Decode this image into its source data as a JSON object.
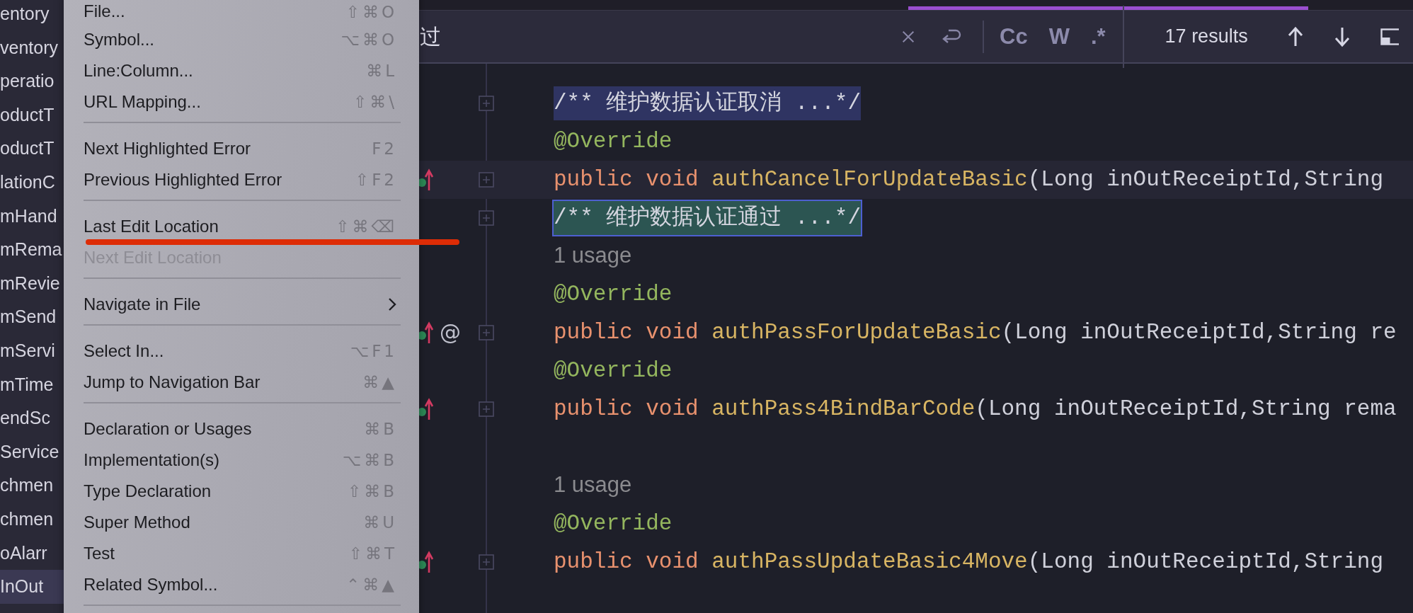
{
  "sidebar": {
    "items": [
      {
        "label": "entory",
        "selected": false
      },
      {
        "label": "ventory",
        "selected": false
      },
      {
        "label": "peratio",
        "selected": false
      },
      {
        "label": "oductT",
        "selected": false
      },
      {
        "label": "oductT",
        "selected": false
      },
      {
        "label": "lationC",
        "selected": false
      },
      {
        "label": "mHand",
        "selected": false
      },
      {
        "label": "mRema",
        "selected": false
      },
      {
        "label": "mRevie",
        "selected": false
      },
      {
        "label": "mSend",
        "selected": false
      },
      {
        "label": "mServi",
        "selected": false
      },
      {
        "label": "mTime",
        "selected": false
      },
      {
        "label": "endSc",
        "selected": false
      },
      {
        "label": "Service",
        "selected": false
      },
      {
        "label": "chmen",
        "selected": false
      },
      {
        "label": "chmen",
        "selected": false
      },
      {
        "label": "oAlarr",
        "selected": false
      },
      {
        "label": "InOut",
        "selected": true
      }
    ]
  },
  "find_bar": {
    "value": "过",
    "toggles": [
      {
        "label": "Cc"
      },
      {
        "label": "W"
      },
      {
        "label": ".*"
      }
    ],
    "results": "17 results"
  },
  "editor": {
    "lines": [
      {
        "kind": "code",
        "match": true,
        "selected_match": false,
        "current": false,
        "override": false,
        "foldable": true,
        "tokens": [
          {
            "kind": "comment",
            "text": "/** 维护数据认证取消 ...*/"
          }
        ]
      },
      {
        "kind": "code",
        "match": false,
        "selected_match": false,
        "current": false,
        "override": false,
        "foldable": false,
        "tokens": [
          {
            "kind": "annotation",
            "text": "@Override"
          }
        ]
      },
      {
        "kind": "code",
        "match": false,
        "selected_match": false,
        "current": true,
        "override": true,
        "foldable": true,
        "tokens": [
          {
            "kind": "keyword",
            "text": "public void "
          },
          {
            "kind": "method",
            "text": "authCancelForUpdateBasic"
          },
          {
            "kind": "plain",
            "text": "(Long inOutReceiptId,String"
          }
        ]
      },
      {
        "kind": "code",
        "match": true,
        "selected_match": true,
        "current": false,
        "override": false,
        "foldable": true,
        "tokens": [
          {
            "kind": "comment",
            "text": "/** 维护数据认证通过 ...*/"
          }
        ]
      },
      {
        "kind": "code",
        "match": false,
        "selected_match": false,
        "current": false,
        "override": false,
        "foldable": false,
        "tokens": [
          {
            "kind": "hint",
            "text": "1 usage"
          }
        ]
      },
      {
        "kind": "code",
        "match": false,
        "selected_match": false,
        "current": false,
        "override": false,
        "foldable": false,
        "tokens": [
          {
            "kind": "annotation",
            "text": "@Override"
          }
        ]
      },
      {
        "kind": "code",
        "match": false,
        "selected_match": false,
        "current": false,
        "override": true,
        "gutter_text": "@",
        "foldable": true,
        "tokens": [
          {
            "kind": "keyword",
            "text": "public void "
          },
          {
            "kind": "method",
            "text": "authPassForUpdateBasic"
          },
          {
            "kind": "plain",
            "text": "(Long inOutReceiptId,String re"
          }
        ]
      },
      {
        "kind": "code",
        "match": false,
        "selected_match": false,
        "current": false,
        "override": false,
        "foldable": false,
        "tokens": [
          {
            "kind": "annotation",
            "text": "@Override"
          }
        ]
      },
      {
        "kind": "code",
        "match": false,
        "selected_match": false,
        "current": false,
        "override": true,
        "foldable": true,
        "tokens": [
          {
            "kind": "keyword",
            "text": "public void "
          },
          {
            "kind": "method",
            "text": "authPass4BindBarCode"
          },
          {
            "kind": "plain",
            "text": "(Long inOutReceiptId,String rema"
          }
        ]
      },
      {
        "kind": "blank"
      },
      {
        "kind": "code",
        "match": false,
        "selected_match": false,
        "current": false,
        "override": false,
        "foldable": false,
        "tokens": [
          {
            "kind": "hint",
            "text": "1 usage"
          }
        ]
      },
      {
        "kind": "code",
        "match": false,
        "selected_match": false,
        "current": false,
        "override": false,
        "foldable": false,
        "tokens": [
          {
            "kind": "annotation",
            "text": "@Override"
          }
        ]
      },
      {
        "kind": "code",
        "match": false,
        "selected_match": false,
        "current": false,
        "override": true,
        "foldable": true,
        "tokens": [
          {
            "kind": "keyword",
            "text": "public void "
          },
          {
            "kind": "method",
            "text": "authPassUpdateBasic4Move"
          },
          {
            "kind": "plain",
            "text": "(Long inOutReceiptId,String"
          }
        ]
      }
    ]
  },
  "context_menu": {
    "groups": [
      [
        {
          "label": "File...",
          "shortcut": "⇧⌘O",
          "disabled": false,
          "submenu": false
        },
        {
          "label": "Symbol...",
          "shortcut": "⌥⌘O",
          "disabled": false,
          "submenu": false
        },
        {
          "label": "Line:Column...",
          "shortcut": "⌘L",
          "disabled": false,
          "submenu": false
        },
        {
          "label": "URL Mapping...",
          "shortcut": "⇧⌘\\",
          "disabled": false,
          "submenu": false
        }
      ],
      [
        {
          "label": "Next Highlighted Error",
          "shortcut": "F2",
          "disabled": false,
          "submenu": false
        },
        {
          "label": "Previous Highlighted Error",
          "shortcut": "⇧F2",
          "disabled": false,
          "submenu": false
        }
      ],
      [
        {
          "label": "Last Edit Location",
          "shortcut": "⇧⌘⌫",
          "disabled": false,
          "submenu": false
        },
        {
          "label": "Next Edit Location",
          "disabled": true,
          "submenu": false
        }
      ],
      [
        {
          "label": "Navigate in File",
          "disabled": false,
          "submenu": true
        }
      ],
      [
        {
          "label": "Select In...",
          "shortcut": "⌥F1",
          "disabled": false,
          "submenu": false
        },
        {
          "label": "Jump to Navigation Bar",
          "shortcut": "⌘▲",
          "disabled": false,
          "submenu": false
        }
      ],
      [
        {
          "label": "Declaration or Usages",
          "shortcut": "⌘B",
          "disabled": false,
          "submenu": false
        },
        {
          "label": "Implementation(s)",
          "shortcut": "⌥⌘B",
          "disabled": false,
          "submenu": false
        },
        {
          "label": "Type Declaration",
          "shortcut": "⇧⌘B",
          "disabled": false,
          "submenu": false
        },
        {
          "label": "Super Method",
          "shortcut": "⌘U",
          "disabled": false,
          "submenu": false
        },
        {
          "label": "Test",
          "shortcut": "⇧⌘T",
          "disabled": false,
          "submenu": false
        },
        {
          "label": "Related Symbol...",
          "shortcut": "⌃⌘▲",
          "disabled": false,
          "submenu": false
        }
      ]
    ]
  }
}
